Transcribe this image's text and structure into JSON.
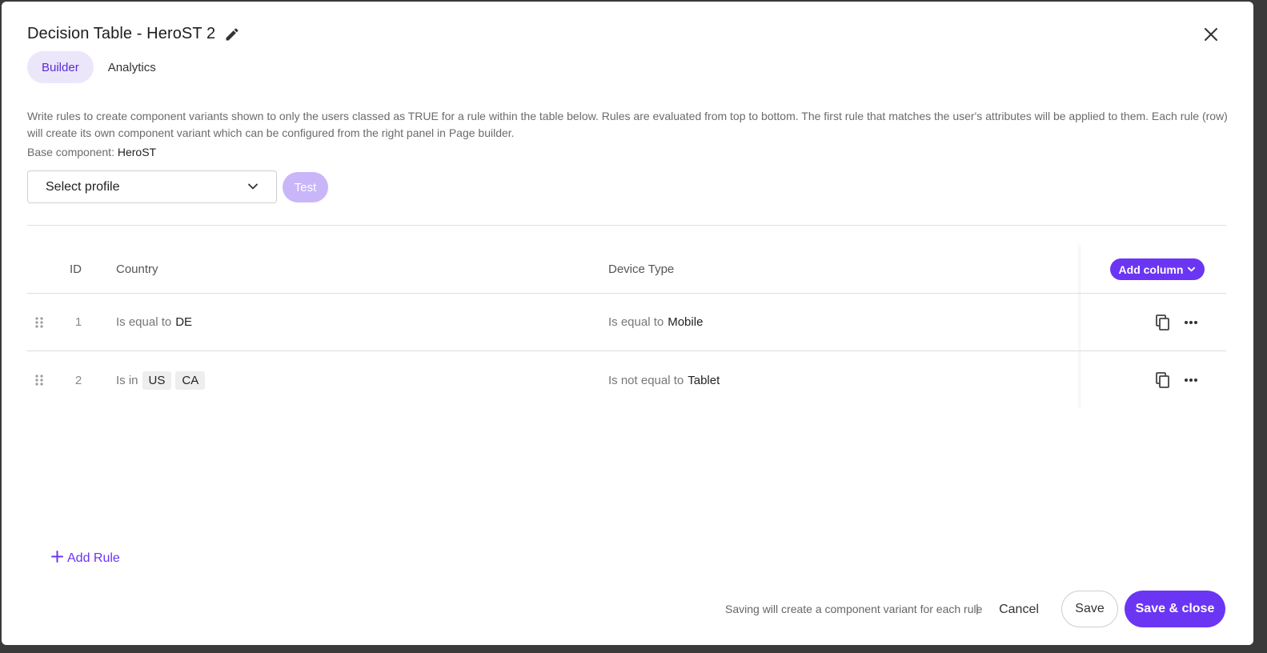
{
  "dialog": {
    "title": "Decision Table - HeroST 2",
    "tabs": [
      {
        "label": "Builder",
        "active": true
      },
      {
        "label": "Analytics",
        "active": false
      }
    ],
    "description": "Write rules to create component variants shown to only the users classed as TRUE for a rule within the table below. Rules are evaluated from top to bottom. The first rule that matches the user's attributes will be applied to them. Each rule (row) will create its own component variant which can be configured from the right panel in Page builder.",
    "base_component_label": "Base component:",
    "base_component_value": "HeroST"
  },
  "profile": {
    "placeholder": "Select profile",
    "test_label": "Test"
  },
  "table": {
    "columns": {
      "id": "ID",
      "country": "Country",
      "device": "Device Type"
    },
    "add_column_label": "Add column",
    "rows": [
      {
        "id": "1",
        "country": {
          "operator": "Is equal to",
          "value": "DE"
        },
        "device": {
          "operator": "Is equal to",
          "value": "Mobile"
        }
      },
      {
        "id": "2",
        "country": {
          "operator": "Is in",
          "chips": [
            "US",
            "CA"
          ]
        },
        "device": {
          "operator": "Is not equal to",
          "value": "Tablet"
        }
      }
    ]
  },
  "add_rule_label": "Add Rule",
  "footer": {
    "note": "Saving will create a component variant for each rule",
    "separator": "|",
    "cancel_label": "Cancel",
    "save_label": "Save",
    "save_close_label": "Save & close"
  },
  "colors": {
    "accent": "#6b35f4",
    "accent_light": "#ece6fb",
    "test_disabled": "#c8b6f9"
  }
}
